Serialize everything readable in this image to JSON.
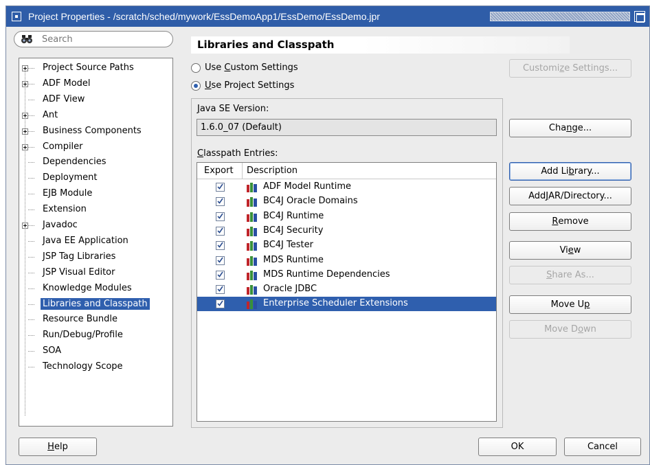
{
  "window": {
    "title": "Project Properties - /scratch/sched/mywork/EssDemoApp1/EssDemo/EssDemo.jpr"
  },
  "search": {
    "placeholder": "Search"
  },
  "nav": {
    "items": [
      {
        "label": "Project Source Paths",
        "expandable": true
      },
      {
        "label": "ADF Model",
        "expandable": true
      },
      {
        "label": "ADF View",
        "expandable": false
      },
      {
        "label": "Ant",
        "expandable": true
      },
      {
        "label": "Business Components",
        "expandable": true
      },
      {
        "label": "Compiler",
        "expandable": true
      },
      {
        "label": "Dependencies",
        "expandable": false
      },
      {
        "label": "Deployment",
        "expandable": false
      },
      {
        "label": "EJB Module",
        "expandable": false
      },
      {
        "label": "Extension",
        "expandable": false
      },
      {
        "label": "Javadoc",
        "expandable": true
      },
      {
        "label": "Java EE Application",
        "expandable": false
      },
      {
        "label": "JSP Tag Libraries",
        "expandable": false
      },
      {
        "label": "JSP Visual Editor",
        "expandable": false
      },
      {
        "label": "Knowledge Modules",
        "expandable": false
      },
      {
        "label": "Libraries and Classpath",
        "expandable": false,
        "selected": true
      },
      {
        "label": "Resource Bundle",
        "expandable": false
      },
      {
        "label": "Run/Debug/Profile",
        "expandable": false
      },
      {
        "label": "SOA",
        "expandable": false
      },
      {
        "label": "Technology Scope",
        "expandable": false
      }
    ]
  },
  "main": {
    "section_title": "Libraries and Classpath",
    "radio_custom": {
      "pre": "Use ",
      "key": "C",
      "post": "ustom Settings"
    },
    "radio_project": {
      "pre": "",
      "key": "U",
      "post": "se Project Settings"
    },
    "customize_button": {
      "pre": "Customi",
      "key": "z",
      "post": "e Settings..."
    },
    "java_version_label": {
      "pre": "",
      "key": "J",
      "post": "ava SE Version:"
    },
    "java_version_value": "1.6.0_07 (Default)",
    "change_button": {
      "pre": "Cha",
      "key": "n",
      "post": "ge..."
    },
    "classpath_label": {
      "pre": "",
      "key": "C",
      "post": "lasspath Entries:"
    },
    "table": {
      "col_export": "Export",
      "col_description": "Description",
      "rows": [
        {
          "description": "ADF Model Runtime",
          "export": true
        },
        {
          "description": "BC4J Oracle Domains",
          "export": true
        },
        {
          "description": "BC4J Runtime",
          "export": true
        },
        {
          "description": "BC4J Security",
          "export": true
        },
        {
          "description": "BC4J Tester",
          "export": true
        },
        {
          "description": "MDS Runtime",
          "export": true
        },
        {
          "description": "MDS Runtime Dependencies",
          "export": true
        },
        {
          "description": "Oracle JDBC",
          "export": true
        },
        {
          "description": "Enterprise Scheduler Extensions",
          "export": true,
          "selected": true
        }
      ]
    },
    "buttons": {
      "add_library": {
        "pre": "Add Li",
        "key": "b",
        "post": "rary..."
      },
      "add_jar": {
        "pre": "Add ",
        "key": "J",
        "post": "AR/Directory..."
      },
      "remove": {
        "pre": "",
        "key": "R",
        "post": "emove"
      },
      "view": {
        "pre": "Vi",
        "key": "e",
        "post": "w"
      },
      "share_as": {
        "pre": "",
        "key": "S",
        "post": "hare As..."
      },
      "move_up": {
        "pre": "Move U",
        "key": "p",
        "post": ""
      },
      "move_down": {
        "pre": "Move D",
        "key": "o",
        "post": "wn"
      }
    }
  },
  "footer": {
    "help": {
      "pre": "",
      "key": "H",
      "post": "elp"
    },
    "ok": "OK",
    "cancel": "Cancel"
  },
  "colors": {
    "titlebar": "#2f5da8",
    "selection": "#2f5fae",
    "dialog_bg": "#ececec",
    "lib_icon_red": "#c0262b",
    "lib_icon_green": "#3a8f3a",
    "lib_icon_blue": "#2b4fa3"
  }
}
